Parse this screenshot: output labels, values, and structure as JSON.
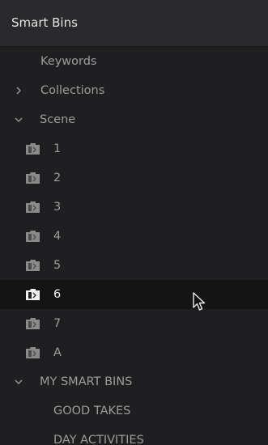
{
  "panel": {
    "title": "Smart Bins"
  },
  "items": [
    {
      "label": "Keywords",
      "kind": "top"
    },
    {
      "label": "Collections",
      "kind": "group",
      "expanded": false
    },
    {
      "label": "Scene",
      "kind": "group",
      "expanded": true
    },
    {
      "label": "1",
      "kind": "bin"
    },
    {
      "label": "2",
      "kind": "bin"
    },
    {
      "label": "3",
      "kind": "bin"
    },
    {
      "label": "4",
      "kind": "bin"
    },
    {
      "label": "5",
      "kind": "bin"
    },
    {
      "label": "6",
      "kind": "bin",
      "selected": true
    },
    {
      "label": "7",
      "kind": "bin"
    },
    {
      "label": "A",
      "kind": "bin"
    },
    {
      "label": "MY SMART BINS",
      "kind": "group",
      "expanded": true
    },
    {
      "label": "GOOD TAKES",
      "kind": "user-bin"
    },
    {
      "label": "DAY ACTIVITIES",
      "kind": "user-bin"
    }
  ],
  "colors": {
    "background": "#1f1f21",
    "header": "#2a2a2c",
    "selected_row": "#141415",
    "text": "#9c9c9c",
    "text_selected": "#f2f2f2"
  },
  "icons": {
    "collapsed": "chevron-right-icon",
    "expanded": "chevron-down-icon",
    "bin": "smart-bin-icon",
    "pointer": "mouse-cursor-icon"
  }
}
